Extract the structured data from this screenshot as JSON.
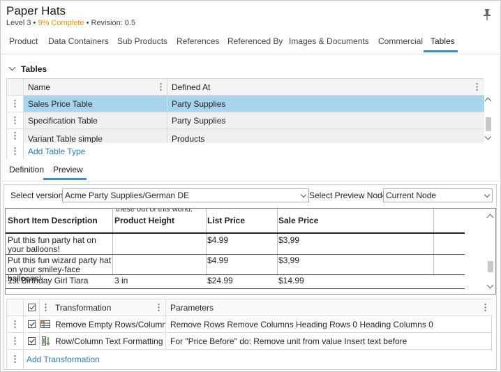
{
  "header": {
    "title": "Paper Hats",
    "level": "Level 3",
    "bullet": "•",
    "complete": "9% Complete",
    "revision": "Revision: 0.5"
  },
  "tabs": [
    "Product",
    "Data Containers",
    "Sub Products",
    "References",
    "Referenced By",
    "Images & Documents",
    "Commercial",
    "Tables"
  ],
  "active_tab": "Tables",
  "tables_section": {
    "title": "Tables",
    "columns": [
      "Name",
      "Defined At"
    ],
    "rows": [
      {
        "name": "Sales Price Table",
        "defined_at": "Party Supplies",
        "selected": true
      },
      {
        "name": "Specification Table",
        "defined_at": "Party Supplies",
        "selected": false
      },
      {
        "name": "Variant Table simple",
        "defined_at": "Products",
        "selected": false
      }
    ],
    "add_link": "Add Table Type"
  },
  "sub_tabs": [
    "Definition",
    "Preview"
  ],
  "active_sub_tab": "Preview",
  "preview_controls": {
    "version_label": "Select version",
    "version_value": "Acme Party Supplies/German DE",
    "node_label": "Select Preview Node",
    "node_value": "Current Node"
  },
  "preview_table": {
    "cut_text": "these out of this world.",
    "headers": [
      "Short Item Description",
      "Product Height",
      "List Price",
      "Sale Price"
    ],
    "rows": [
      [
        "Put this fun party hat on your balloons!",
        "",
        "$4.99",
        "$3,99"
      ],
      [
        "Put this fun wizard party hat on your smiley-face balloons!",
        "",
        "$4.99",
        "$3,99"
      ],
      [
        "1st Birthday Girl Tiara",
        "3 in",
        "$24.99",
        "$14.99"
      ]
    ]
  },
  "transformations": {
    "columns": [
      "Transformation",
      "Parameters"
    ],
    "rows": [
      {
        "checked": true,
        "icon": "table-rows-icon",
        "name": "Remove Empty Rows/Columns",
        "params": "Remove Rows Remove Columns Heading Rows 0 Heading Columns 0"
      },
      {
        "checked": true,
        "icon": "text-format-icon",
        "name": "Row/Column Text Formatting",
        "params": "For \"Price Before\" do: Remove unit from value Insert text before"
      }
    ],
    "add_link": "Add Transformation"
  },
  "colors": {
    "accent": "#3b8ccb",
    "selected_row": "#a9d4ee",
    "complete": "#e8940a",
    "link": "#2b7cc4"
  }
}
